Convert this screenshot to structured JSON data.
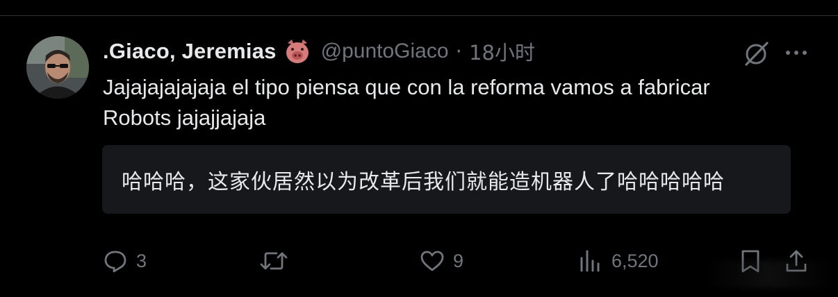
{
  "author": {
    "display_name": ".Giaco, Jeremias",
    "name_emoji": "pig-face-emoji",
    "handle": "@puntoGiaco",
    "separator": "·",
    "time": "18小时"
  },
  "tweet": {
    "text_line1": "Jajajajajajaja el tipo piensa que con la reforma vamos a fabricar",
    "text_line2": "Robots jajajjajaja"
  },
  "translation": {
    "text": "哈哈哈，这家伙居然以为改革后我们就能造机器人了哈哈哈哈哈"
  },
  "actions": {
    "reply": {
      "icon": "reply-icon",
      "count": "3"
    },
    "retweet": {
      "icon": "retweet-icon",
      "count": ""
    },
    "like": {
      "icon": "heart-icon",
      "count": "9"
    },
    "views": {
      "icon": "views-icon",
      "count": "6,520"
    },
    "bookmark": {
      "icon": "bookmark-icon"
    },
    "share": {
      "icon": "share-icon"
    }
  },
  "colors": {
    "background": "#000000",
    "text_primary": "#e7e9ea",
    "text_secondary": "#71767b",
    "translation_bg": "#16181c",
    "divider": "#2f3336"
  }
}
